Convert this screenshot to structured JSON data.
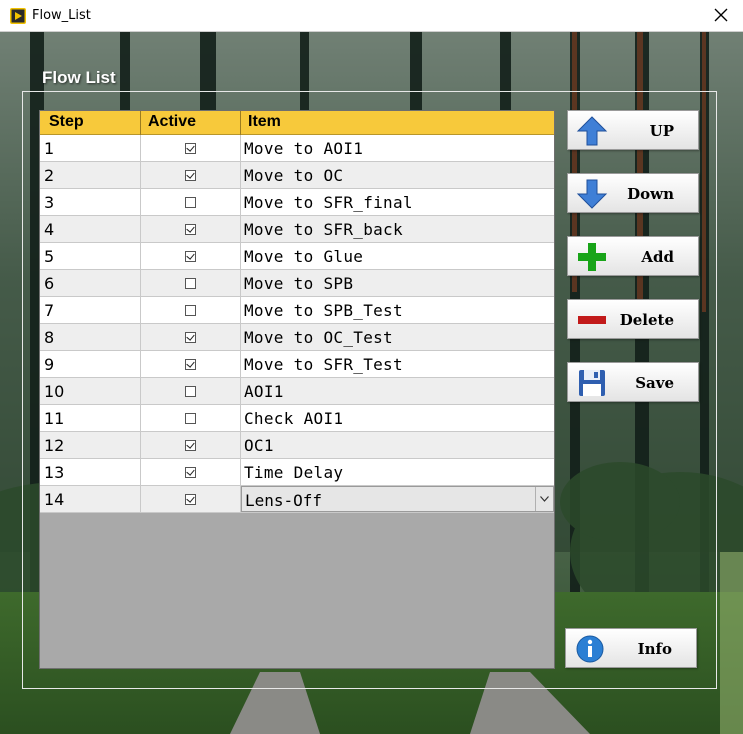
{
  "window": {
    "title": "Flow_List",
    "app_icon": "labview-run-icon",
    "close_icon": "close-icon"
  },
  "group": {
    "title": "Flow List"
  },
  "table": {
    "headers": {
      "step": "Step",
      "active": "Active",
      "item": "Item"
    },
    "rows": [
      {
        "step": "1",
        "active": true,
        "item": "Move to AOI1"
      },
      {
        "step": "2",
        "active": true,
        "item": "Move to OC"
      },
      {
        "step": "3",
        "active": false,
        "item": "Move to SFR_final"
      },
      {
        "step": "4",
        "active": true,
        "item": "Move to SFR_back"
      },
      {
        "step": "5",
        "active": true,
        "item": "Move to Glue"
      },
      {
        "step": "6",
        "active": false,
        "item": "Move to SPB"
      },
      {
        "step": "7",
        "active": false,
        "item": "Move to SPB_Test"
      },
      {
        "step": "8",
        "active": true,
        "item": "Move to OC_Test"
      },
      {
        "step": "9",
        "active": true,
        "item": "Move to SFR_Test"
      },
      {
        "step": "10",
        "active": false,
        "item": "AOI1"
      },
      {
        "step": "11",
        "active": false,
        "item": "Check AOI1"
      },
      {
        "step": "12",
        "active": true,
        "item": "OC1"
      },
      {
        "step": "13",
        "active": true,
        "item": "Time Delay"
      },
      {
        "step": "14",
        "active": true,
        "item": "Lens-Off",
        "editing": true
      }
    ]
  },
  "buttons": {
    "up": "UP",
    "down": "Down",
    "add": "Add",
    "delete": "Delete",
    "save": "Save",
    "info": "Info"
  },
  "colors": {
    "header": "#f7c93b",
    "row_alt": "#eeeeee",
    "empty_area": "#a9a9a9",
    "up_arrow": "#3f7fd6",
    "add_plus": "#18a418",
    "delete_minus": "#c21a1a"
  }
}
